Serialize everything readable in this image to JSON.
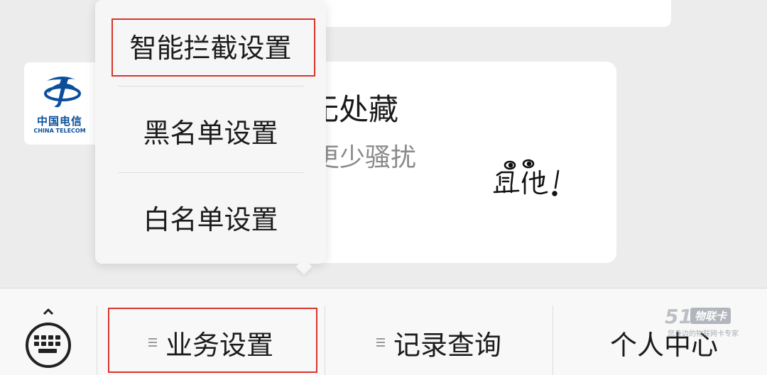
{
  "popup_menu": {
    "items": [
      {
        "label": "智能拦截设置"
      },
      {
        "label": "黑名单设置"
      },
      {
        "label": "白名单设置"
      }
    ]
  },
  "avatar": {
    "name_cn": "中国电信",
    "name_en": "CHINA TELECOM"
  },
  "message_card": {
    "title_fragment": "无处藏",
    "subtitle_fragment": "更少骚扰",
    "doodle_text": "盘他!"
  },
  "bottom_bar": {
    "tabs": [
      {
        "label": "业务设置"
      },
      {
        "label": "记录查询"
      },
      {
        "label": "个人中心"
      }
    ]
  },
  "watermark": {
    "number": "51",
    "brand": "物联卡",
    "slogan": "您身边的物联网卡专家"
  },
  "colors": {
    "highlight": "#d9342c",
    "brand_blue": "#0b4f9c"
  }
}
